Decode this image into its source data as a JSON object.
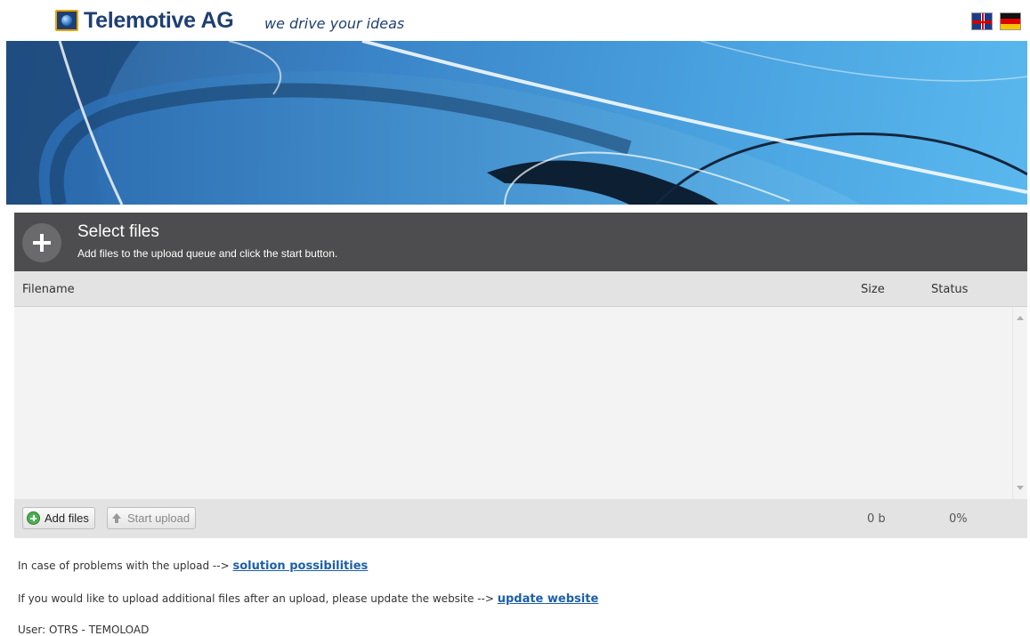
{
  "header": {
    "brand": "Telemotive AG",
    "tagline": "we drive your ideas"
  },
  "uploader": {
    "title": "Select files",
    "subtitle": "Add files to the upload queue and click the start button.",
    "columns": {
      "filename": "Filename",
      "size": "Size",
      "status": "Status"
    },
    "add_files_label": "Add files",
    "start_upload_label": "Start upload",
    "total_size": "0 b",
    "total_percent": "0%"
  },
  "info": {
    "problems_text": "In case of problems with the upload --> ",
    "problems_link": "solution possibilities",
    "update_text": "If you would like to upload additional files after an upload, please update the website --> ",
    "update_link": "update website",
    "user_text": "User: OTRS - TEMOLOAD"
  },
  "icons": {
    "logo": "telemotive-logo-icon",
    "flag_en": "uk-flag-icon",
    "flag_de": "german-flag-icon",
    "add": "plus-circle-icon",
    "start": "arrow-up-icon"
  },
  "colors": {
    "brand": "#1f3f72",
    "uploader_header": "#4d4d4f",
    "link": "#1d5fa8"
  }
}
